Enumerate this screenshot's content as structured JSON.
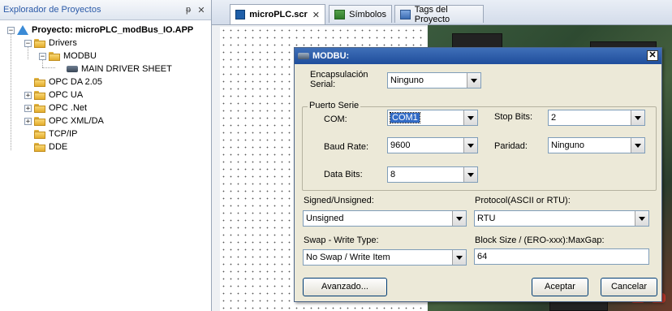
{
  "explorer": {
    "title": "Explorador de Proyectos",
    "pin_glyph": "ᵽ",
    "close_glyph": "✕",
    "tree": {
      "project": "Proyecto: microPLC_modBus_IO.APP",
      "drivers": "Drivers",
      "modbu": "MODBU",
      "main_driver_sheet": "MAIN DRIVER SHEET",
      "opc_da": "OPC DA 2.05",
      "opc_ua": "OPC UA",
      "opc_net": "OPC .Net",
      "opc_xml": "OPC XML/DA",
      "tcpip": "TCP/IP",
      "dde": "DDE"
    },
    "expand_glyphs": {
      "minus": "−",
      "plus": "+"
    }
  },
  "tabs": [
    {
      "label": "microPLC.scr",
      "icon": "screen-icon",
      "active": true,
      "close": "✕"
    },
    {
      "label": "Símbolos",
      "icon": "symbols-icon"
    },
    {
      "label": "Tags del Proyecto",
      "icon": "tags-icon"
    }
  ],
  "dialog": {
    "title": "MODBU:",
    "close_glyph": "✕",
    "encapsulacion_label": "Encapsulación Serial:",
    "encapsulacion_value": "Ninguno",
    "puerto_serie_title": "Puerto Serie",
    "com_label": "COM:",
    "com_value": "COM1",
    "stop_bits_label": "Stop Bits:",
    "stop_bits_value": "2",
    "baud_rate_label": "Baud Rate:",
    "baud_rate_value": "9600",
    "paridad_label": "Paridad:",
    "paridad_value": "Ninguno",
    "data_bits_label": "Data Bits:",
    "data_bits_value": "8",
    "signed_label": "Signed/Unsigned:",
    "signed_value": "Unsigned",
    "protocol_label": "Protocol(ASCII or RTU):",
    "protocol_value": "RTU",
    "swap_label": "Swap - Write Type:",
    "swap_value": "No Swap / Write Item",
    "block_label": "Block Size / (ERO-xxx):MaxGap:",
    "block_value": "64",
    "avanzado_button": "Avanzado...",
    "aceptar_button": "Aceptar",
    "cancelar_button": "Cancelar"
  }
}
